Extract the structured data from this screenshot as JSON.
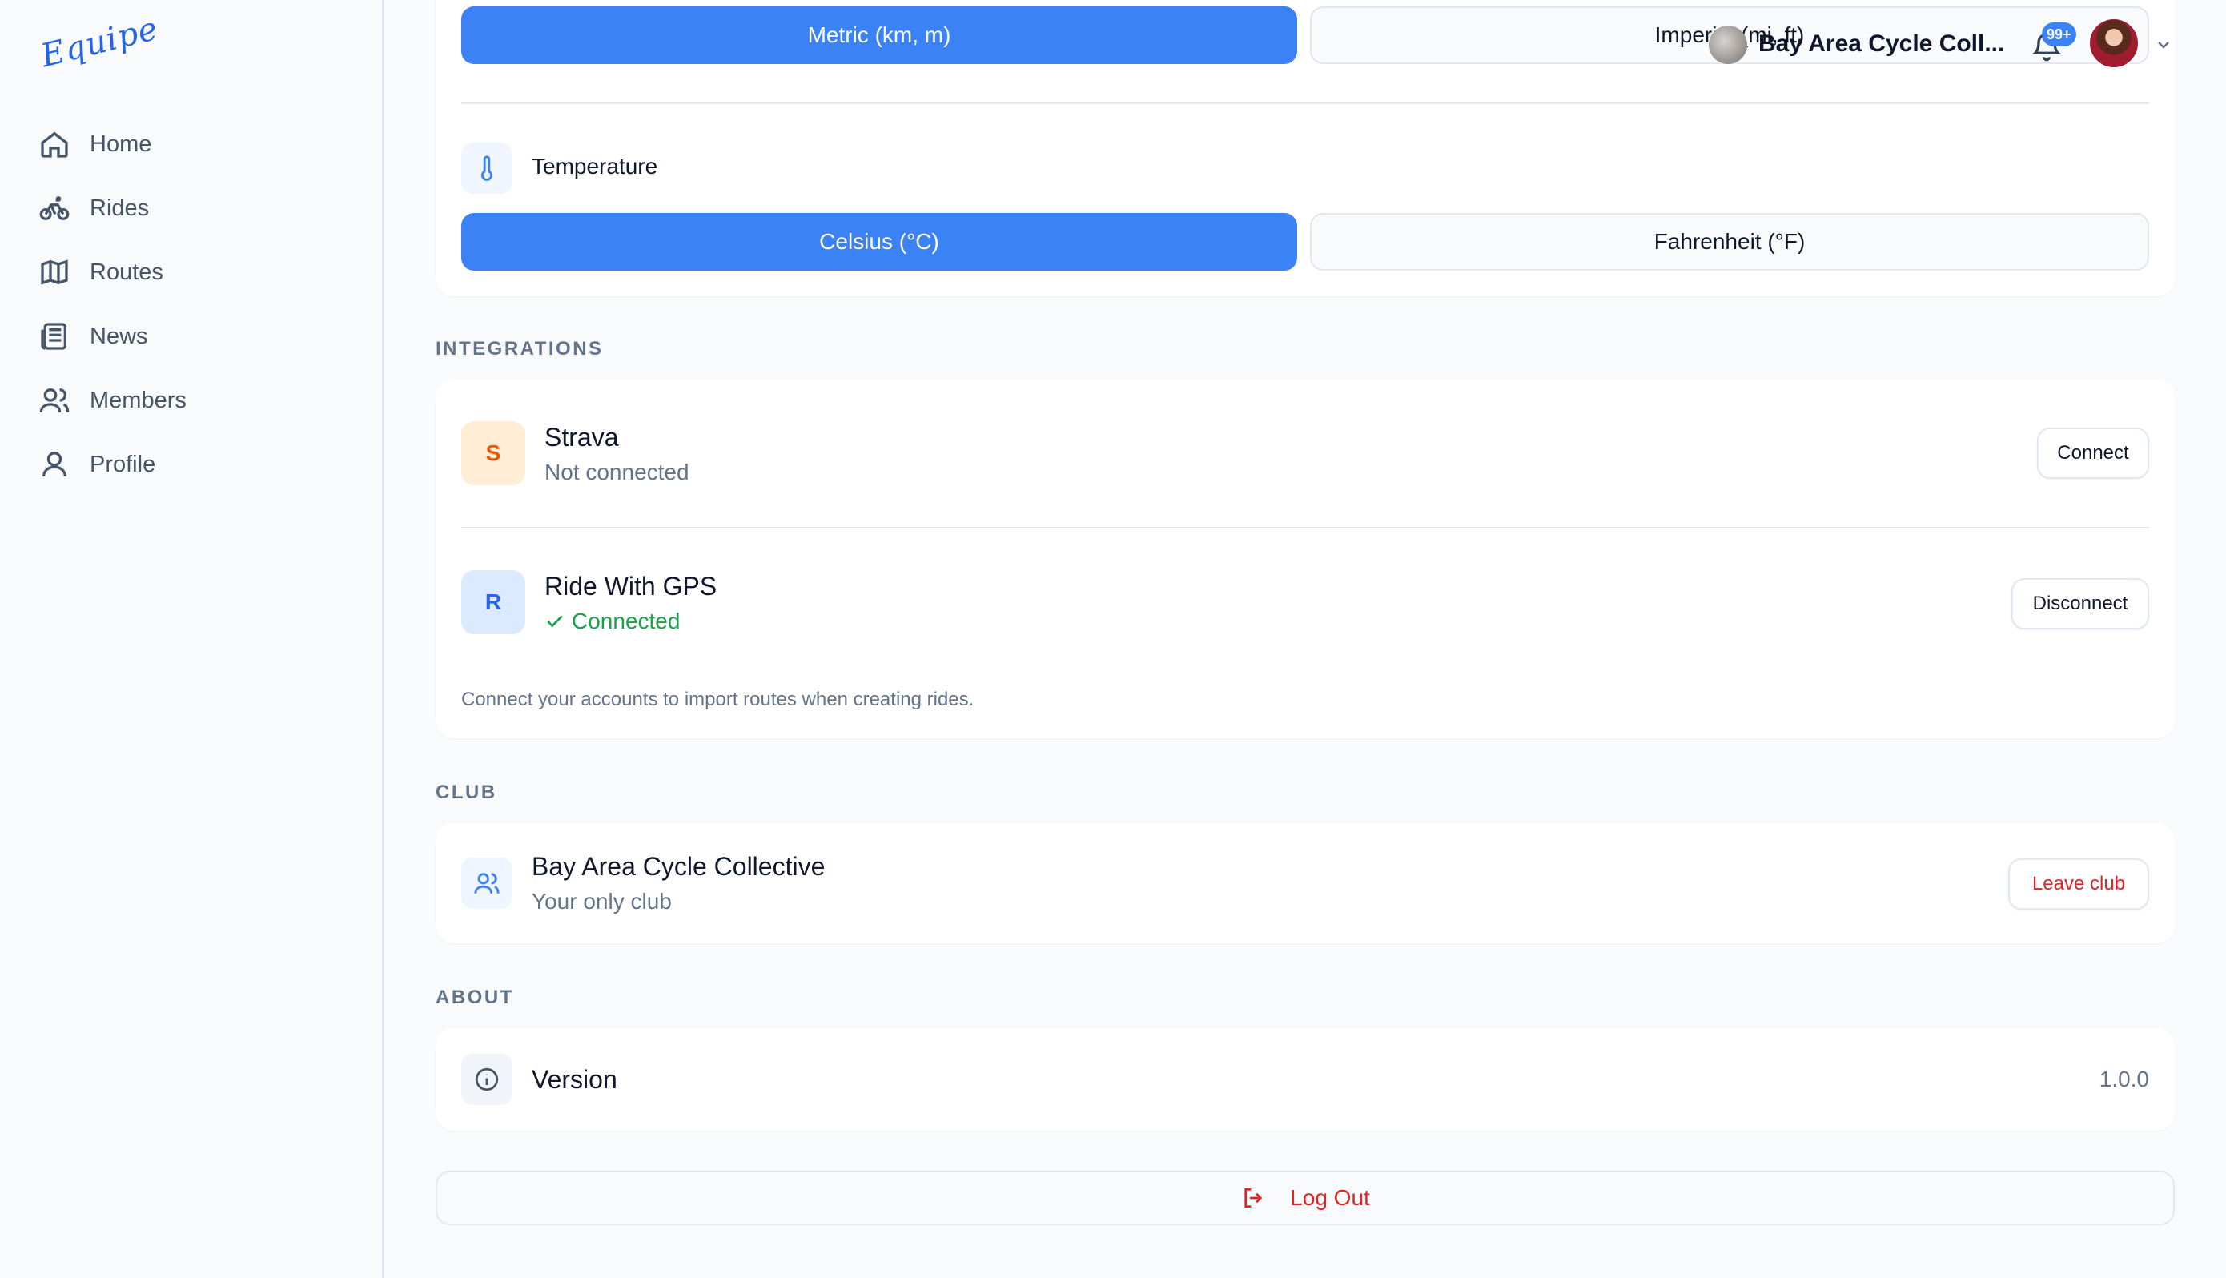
{
  "app": {
    "logo_text": "Equipe"
  },
  "sidebar": {
    "items": [
      {
        "label": "Home",
        "icon": "home-icon"
      },
      {
        "label": "Rides",
        "icon": "bicycle-icon"
      },
      {
        "label": "Routes",
        "icon": "map-icon"
      },
      {
        "label": "News",
        "icon": "newspaper-icon"
      },
      {
        "label": "Members",
        "icon": "users-icon"
      },
      {
        "label": "Profile",
        "icon": "user-icon"
      }
    ]
  },
  "header": {
    "club_name": "Bay Area Cycle Coll...",
    "notification_count": "99+"
  },
  "units": {
    "distance": {
      "metric_label": "Metric (km, m)",
      "imperial_label": "Imperial (mi, ft)",
      "selected": "metric"
    },
    "temperature": {
      "title": "Temperature",
      "celsius_label": "Celsius (°C)",
      "fahrenheit_label": "Fahrenheit (°F)",
      "selected": "celsius"
    }
  },
  "integrations": {
    "section_label": "INTEGRATIONS",
    "items": [
      {
        "initial": "S",
        "name": "Strava",
        "status": "Not connected",
        "action": "Connect",
        "connected": false
      },
      {
        "initial": "R",
        "name": "Ride With GPS",
        "status": "Connected",
        "action": "Disconnect",
        "connected": true
      }
    ],
    "footnote": "Connect your accounts to import routes when creating rides."
  },
  "club": {
    "section_label": "CLUB",
    "name": "Bay Area Cycle Collective",
    "subtitle": "Your only club",
    "action": "Leave club"
  },
  "about": {
    "section_label": "ABOUT",
    "version_label": "Version",
    "version_value": "1.0.0"
  },
  "logout": {
    "label": "Log Out"
  },
  "colors": {
    "accent": "#3b82f6",
    "danger": "#dc2626",
    "success": "#16a34a",
    "strava_bg": "#ffedd5",
    "strava_fg": "#ea580c",
    "rwgps_bg": "#dbeafe",
    "rwgps_fg": "#2563eb"
  }
}
